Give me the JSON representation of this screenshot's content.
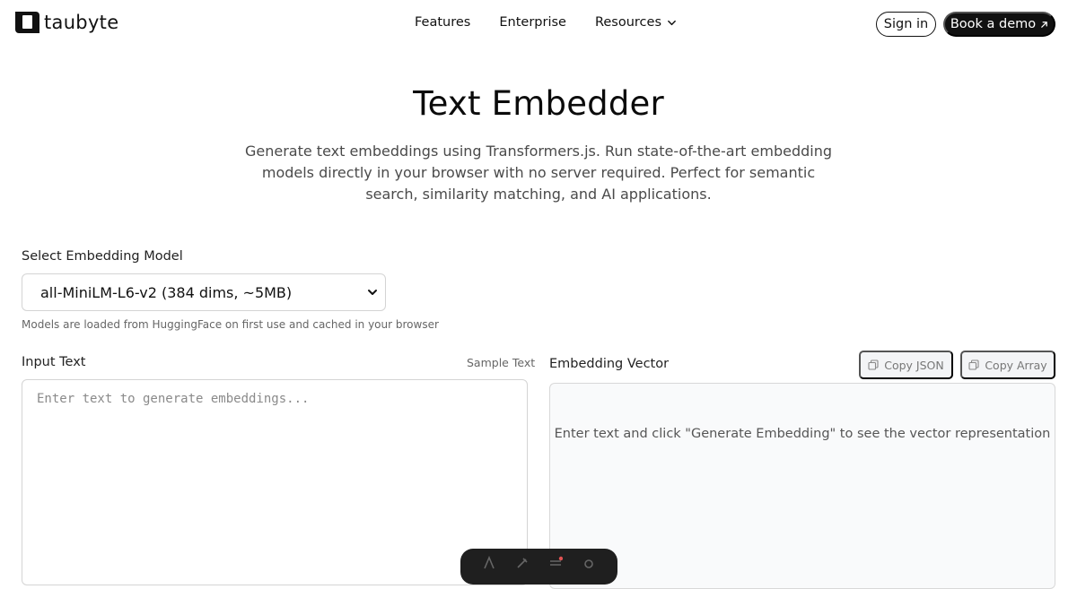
{
  "brand": {
    "name": "taubyte",
    "logo_icon": "taubyte-logo-icon"
  },
  "nav": {
    "items": [
      {
        "label": "Features"
      },
      {
        "label": "Enterprise"
      },
      {
        "label": "Resources",
        "icon": "chevron-down-icon"
      }
    ],
    "signin_label": "Sign in",
    "demo_label": "Book a demo",
    "demo_icon": "arrow-up-right-icon"
  },
  "hero": {
    "title": "Text Embedder",
    "subtitle": "Generate text embeddings using Transformers.js. Run state-of-the-art embedding models directly in your browser with no server required. Perfect for semantic search, similarity matching, and AI applications."
  },
  "model": {
    "label": "Select Embedding Model",
    "selected": "all-MiniLM-L6-v2 (384 dims, ~5MB)",
    "hint": "Models are loaded from HuggingFace on first use and cached in your browser"
  },
  "input": {
    "label": "Input Text",
    "sample_link": "Sample Text",
    "value": "",
    "placeholder": "Enter text to generate embeddings..."
  },
  "output": {
    "label": "Embedding Vector",
    "copy_json_label": "Copy JSON",
    "copy_array_label": "Copy Array",
    "empty_message": "Enter text and click \"Generate Embedding\" to see the vector representation"
  },
  "colors": {
    "primary_dark": "#111111",
    "text_muted": "#666666",
    "panel_bg": "#f9fafb",
    "border": "#d4d4d4"
  }
}
